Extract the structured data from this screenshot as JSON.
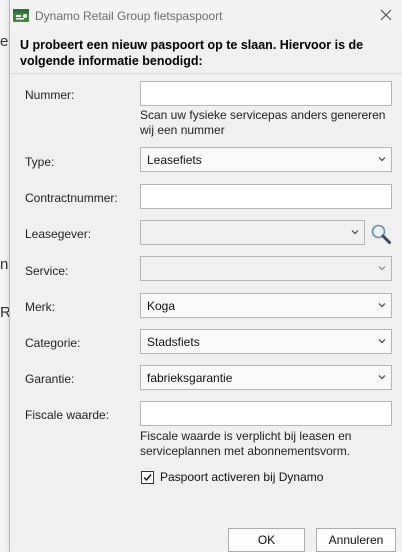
{
  "background": {
    "fragments": [
      "e",
      "R",
      "n",
      "R"
    ]
  },
  "dialog": {
    "title": "Dynamo Retail Group fietspaspoort",
    "heading_line1": "U probeert een nieuw paspoort op te slaan. Hiervoor is de",
    "heading_line2": "volgende informatie benodigd:"
  },
  "form": {
    "nummer": {
      "label": "Nummer:",
      "value": "",
      "hint_line1": "Scan uw fysieke servicepas anders genereren",
      "hint_line2": "wij een nummer"
    },
    "type": {
      "label": "Type:",
      "value": "Leasefiets"
    },
    "contractnummer": {
      "label": "Contractnummer:",
      "value": ""
    },
    "leasegever": {
      "label": "Leasegever:",
      "value": ""
    },
    "service": {
      "label": "Service:",
      "value": ""
    },
    "merk": {
      "label": "Merk:",
      "value": "Koga"
    },
    "categorie": {
      "label": "Categorie:",
      "value": "Stadsfiets"
    },
    "garantie": {
      "label": "Garantie:",
      "value": "fabrieksgarantie"
    },
    "fiscale_waarde": {
      "label": "Fiscale waarde:",
      "value": "",
      "hint_line1": "Fiscale waarde is verplicht bij leasen en",
      "hint_line2": "serviceplannen met abonnementsvorm."
    },
    "activate": {
      "label": "Paspoort activeren bij Dynamo",
      "checked": true
    }
  },
  "buttons": {
    "ok": "OK",
    "cancel": "Annuleren"
  },
  "icons": {
    "app": "dynamo-app-icon",
    "close": "close-icon",
    "search": "magnifier-icon",
    "dropdown": "chevron-down-icon",
    "check": "checkmark-icon"
  },
  "colors": {
    "app_icon_green": "#3a8a3a",
    "dialog_bg": "#f0f0f0"
  }
}
